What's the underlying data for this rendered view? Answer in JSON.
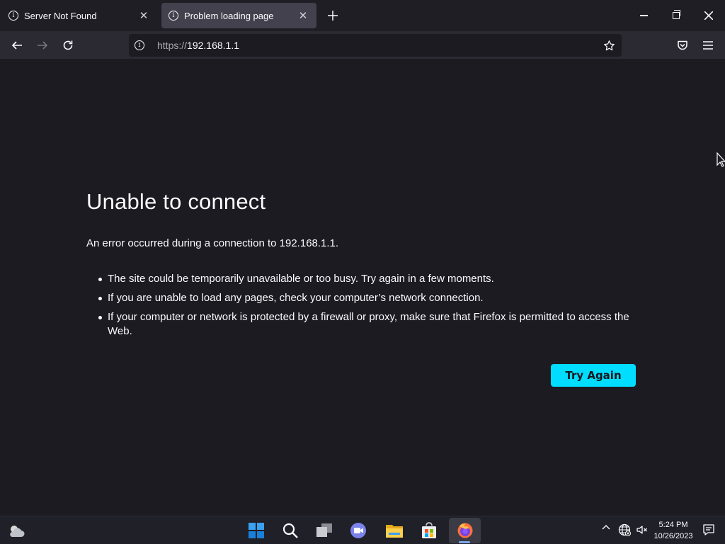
{
  "tabs": [
    {
      "title": "Server Not Found",
      "active": false
    },
    {
      "title": "Problem loading page",
      "active": true
    }
  ],
  "url": {
    "scheme": "https://",
    "host": "192.168.1.1"
  },
  "error": {
    "title": "Unable to connect",
    "description": "An error occurred during a connection to 192.168.1.1.",
    "suggestions": [
      "The site could be temporarily unavailable or too busy. Try again in a few moments.",
      "If you are unable to load any pages, check your computer’s network connection.",
      "If your computer or network is protected by a firewall or proxy, make sure that Firefox is permitted to access the Web."
    ],
    "try_again_label": "Try Again"
  },
  "taskbar": {
    "time": "5:24 PM",
    "date": "10/26/2023"
  },
  "icons": [
    "info-icon",
    "close-icon",
    "plus-icon",
    "minimize-icon",
    "restore-icon",
    "back-arrow-icon",
    "forward-arrow-icon",
    "reload-icon",
    "star-icon",
    "pocket-icon",
    "hamburger-menu-icon",
    "weather-icon",
    "windows-start-icon",
    "search-icon",
    "task-view-icon",
    "chat-icon",
    "file-explorer-icon",
    "store-icon",
    "firefox-icon",
    "chevron-up-icon",
    "globe-icon",
    "volume-muted-icon",
    "notification-icon"
  ],
  "colors": {
    "accent": "#00ddff",
    "background": "#1c1b22",
    "toolbar": "#2b2a33",
    "active_tab": "#42414d"
  }
}
